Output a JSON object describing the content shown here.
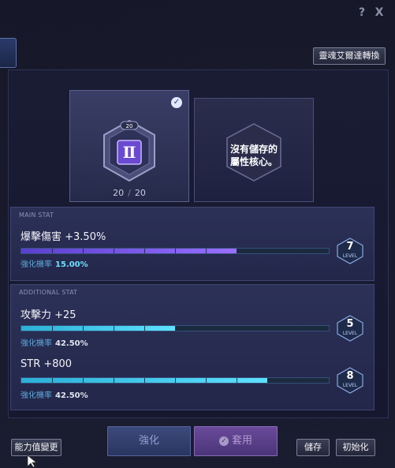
{
  "window": {
    "help_label": "?",
    "close_label": "X"
  },
  "top_right_button": "靈魂艾爾達轉換",
  "core": {
    "roman": "Ⅱ",
    "badge_number": "20",
    "count_current": "20",
    "count_sep": "/",
    "count_max": "20"
  },
  "empty_core_text": "沒有儲存的\n屬性核心。",
  "main_stat": {
    "label": "MAIN STAT",
    "name": "爆擊傷害 +3.50%",
    "rate_label": "強化機率",
    "rate_value": "15.00%",
    "level": "7",
    "progress": 0.7
  },
  "additional_stat": {
    "label": "ADDITIONAL STAT",
    "items": [
      {
        "name": "攻擊力 +25",
        "rate_label": "強化機率",
        "rate_value": "42.50%",
        "level": "5",
        "progress": 0.5
      },
      {
        "name": "STR +800",
        "rate_label": "強化機率",
        "rate_value": "42.50%",
        "level": "8",
        "progress": 0.8
      }
    ]
  },
  "level_word": "LEVEL",
  "buttons": {
    "enhance": "強化",
    "apply": "套用",
    "change_stats": "能力值變更",
    "save": "儲存",
    "reset": "初始化"
  },
  "colors": {
    "main_bar": "#7a55ee",
    "add_bar": "#3cc4e8",
    "rate_highlight": "#6de0ff"
  }
}
